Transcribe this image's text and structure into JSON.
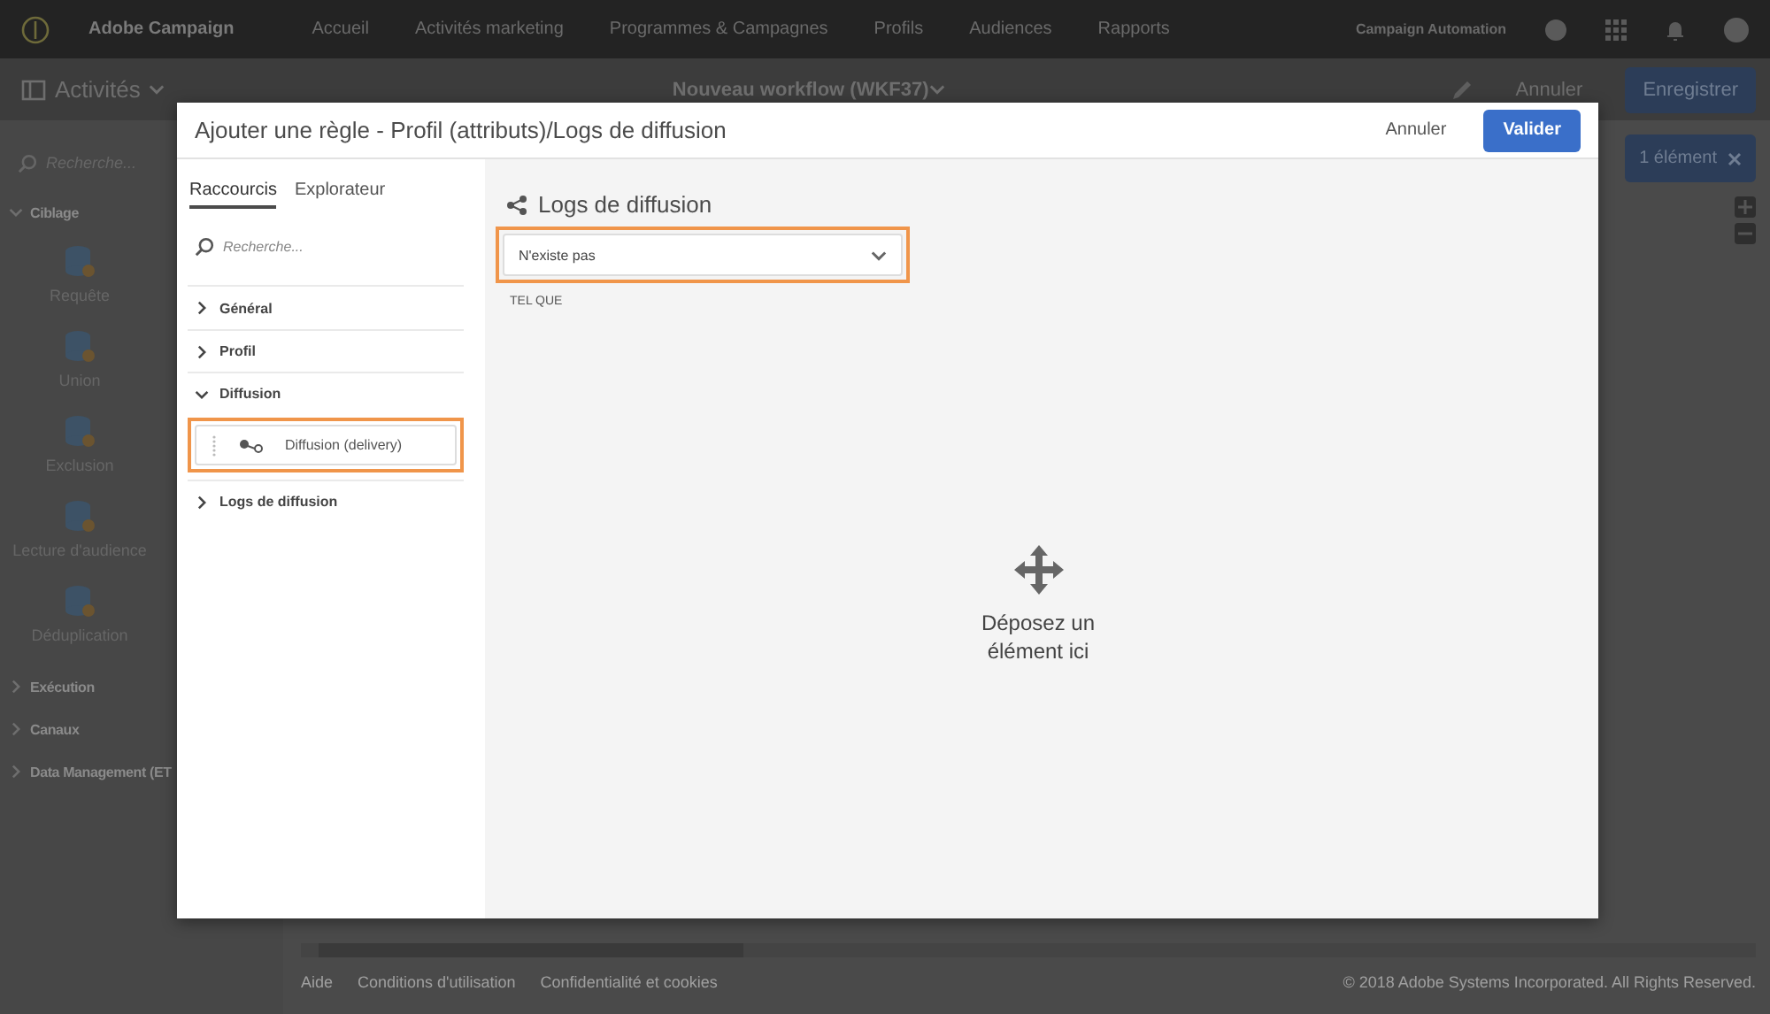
{
  "topbar": {
    "brand": "Adobe Campaign",
    "nav": [
      "Accueil",
      "Activités marketing",
      "Programmes & Campagnes",
      "Profils",
      "Audiences",
      "Rapports"
    ],
    "instance": "Campaign Automation"
  },
  "toolbar": {
    "menu": "Activités",
    "workflow_title": "Nouveau workflow (WKF37)",
    "buttons": [
      {
        "label": "Annuler",
        "kind": "secondary"
      },
      {
        "label": "Enregistrer",
        "kind": "primary"
      }
    ]
  },
  "palette": {
    "search": {
      "placeholder": "Recherche..."
    },
    "groups": [
      {
        "label": "Ciblage",
        "expanded": true,
        "activities": [
          "Requête",
          "Union",
          "Exclusion",
          "Lecture d'audience",
          "Déduplication"
        ]
      },
      {
        "label": "Exécution",
        "expanded": false
      },
      {
        "label": "Canaux",
        "expanded": false
      },
      {
        "label": "Data Management (ET",
        "expanded": false
      }
    ]
  },
  "canvas": {
    "selection_chip": "1 élément",
    "footer_links": [
      "Aide",
      "Conditions d'utilisation",
      "Confidentialité et cookies"
    ],
    "copyright": "© 2018 Adobe Systems Incorporated. All Rights Reserved."
  },
  "dialog": {
    "title": "Ajouter une règle - Profil (attributs)/Logs de diffusion",
    "buttons": [
      {
        "label": "Annuler",
        "kind": "secondary"
      },
      {
        "label": "Valider",
        "kind": "primary"
      }
    ],
    "tabs": [
      {
        "label": "Raccourcis",
        "selected": true
      },
      {
        "label": "Explorateur",
        "selected": false
      }
    ],
    "search": {
      "placeholder": "Recherche..."
    },
    "tree": [
      {
        "label": "Général",
        "expanded": false
      },
      {
        "label": "Profil",
        "expanded": false
      },
      {
        "label": "Diffusion",
        "expanded": true,
        "children": [
          {
            "label": "Diffusion (delivery)",
            "highlighted": true
          }
        ]
      },
      {
        "label": "Logs de diffusion",
        "expanded": false
      }
    ],
    "rule": {
      "title": "Logs de diffusion",
      "operator": {
        "value": "N'existe pas",
        "highlighted": true
      },
      "condition_label": "TEL QUE",
      "drop_zone": "Déposez un élément ici"
    }
  }
}
